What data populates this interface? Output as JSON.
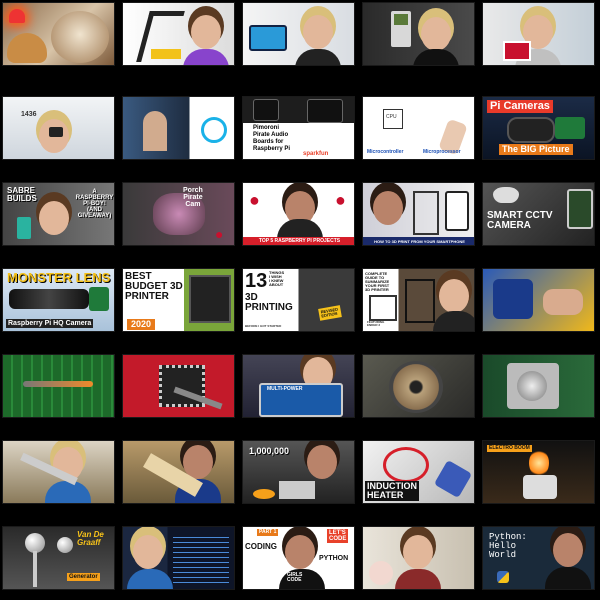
{
  "grid": {
    "background": "#000000",
    "columns": 5,
    "rows": 7
  },
  "thumbs": {
    "t00": {
      "title": ""
    },
    "t01": {
      "title": ""
    },
    "t02": {
      "title": ""
    },
    "t03": {
      "title": ""
    },
    "t04": {
      "title": ""
    },
    "t10": {
      "title": "1436"
    },
    "t11": {
      "title": ""
    },
    "t12": {
      "line1": "Pimoroni",
      "line2": "Pirate Audio",
      "line3": "Boards for",
      "line4": "Raspberry Pi",
      "brand": "sparkfun"
    },
    "t13": {
      "left": "Microcontroller",
      "right": "Microprocessor",
      "chip": "CPU"
    },
    "t14": {
      "title": "Pi Cameras",
      "subtitle": "The BIG Picture"
    },
    "t20": {
      "left": "SABRE\nBUILDS",
      "right": "A\nRASPBERRY\nPI-BOY!\n(AND GIVEAWAY)"
    },
    "t21": {
      "title": "Porch\nPirate\nCam"
    },
    "t22": {
      "title": "TOP 5 RASPBERRY PI PROJECTS"
    },
    "t23": {
      "title": "HOW TO 3D PRINT FROM YOUR SMARTPHONE"
    },
    "t24": {
      "title": "SMART CCTV\nCAMERA"
    },
    "t30": {
      "title": "MONSTER LENS",
      "subtitle": "Raspberry Pi HQ Camera"
    },
    "t31": {
      "title": "BEST\nBUDGET 3D\nPRINTER",
      "year": "2020"
    },
    "t32": {
      "big": "13",
      "small": "THINGS\nI WISH\nI KNEW\nABOUT",
      "main": "3D\nPRINTING",
      "foot": "BEFORE I GOT STARTED",
      "tag": "REVISED\nEDITION"
    },
    "t33": {
      "title": "COMPLETE\nGUIDE TO\nSUMMARIZE YOUR FIRST\n3D PRINTER",
      "foot": "FEATURING\nENDER 3"
    },
    "t34": {
      "title": ""
    },
    "t40": {
      "title": ""
    },
    "t41": {
      "title": ""
    },
    "t42": {
      "title": "MULTI-POWER"
    },
    "t43": {
      "title": ""
    },
    "t44": {
      "title": ""
    },
    "t50": {
      "title": ""
    },
    "t51": {
      "title": ""
    },
    "t52": {
      "title": "1,000,000"
    },
    "t53": {
      "title": "INDUCTION\nHEATER"
    },
    "t54": {
      "title": "ELECTRO BOOM"
    },
    "t60": {
      "title": "Van De\nGraaff",
      "sub": "Generator"
    },
    "t61": {
      "title": ""
    },
    "t62": {
      "badge": "PART 1",
      "left": "CODING",
      "right": "PYTHON",
      "lets": "LET'S\nCODE",
      "girls": "GIRLS\nCODE"
    },
    "t63": {
      "title": ""
    },
    "t64": {
      "title": "Python:\nHello\nWorld"
    }
  }
}
